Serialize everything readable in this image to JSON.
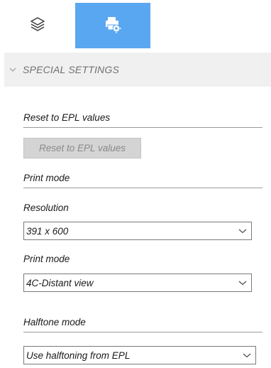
{
  "tabs": [
    {
      "name": "layers",
      "icon": "layers-icon",
      "active": false
    },
    {
      "name": "printer-settings",
      "icon": "printer-settings-icon",
      "active": true
    }
  ],
  "section": {
    "title": "SPECIAL SETTINGS",
    "expanded": true
  },
  "reset_group": {
    "title": "Reset to EPL values",
    "button_label": "Reset to EPL values",
    "button_enabled": false
  },
  "print_mode_group": {
    "title": "Print mode",
    "resolution": {
      "label": "Resolution",
      "value": "391 x 600"
    },
    "print_mode": {
      "label": "Print mode",
      "value": "4C-Distant view"
    }
  },
  "halftone_group": {
    "title": "Halftone mode",
    "value": "Use halftoning from EPL"
  },
  "colors": {
    "active_tab": "#5aa7f1",
    "header_bg": "#f0f0f0",
    "disabled_button_bg": "#d4d4d4"
  }
}
